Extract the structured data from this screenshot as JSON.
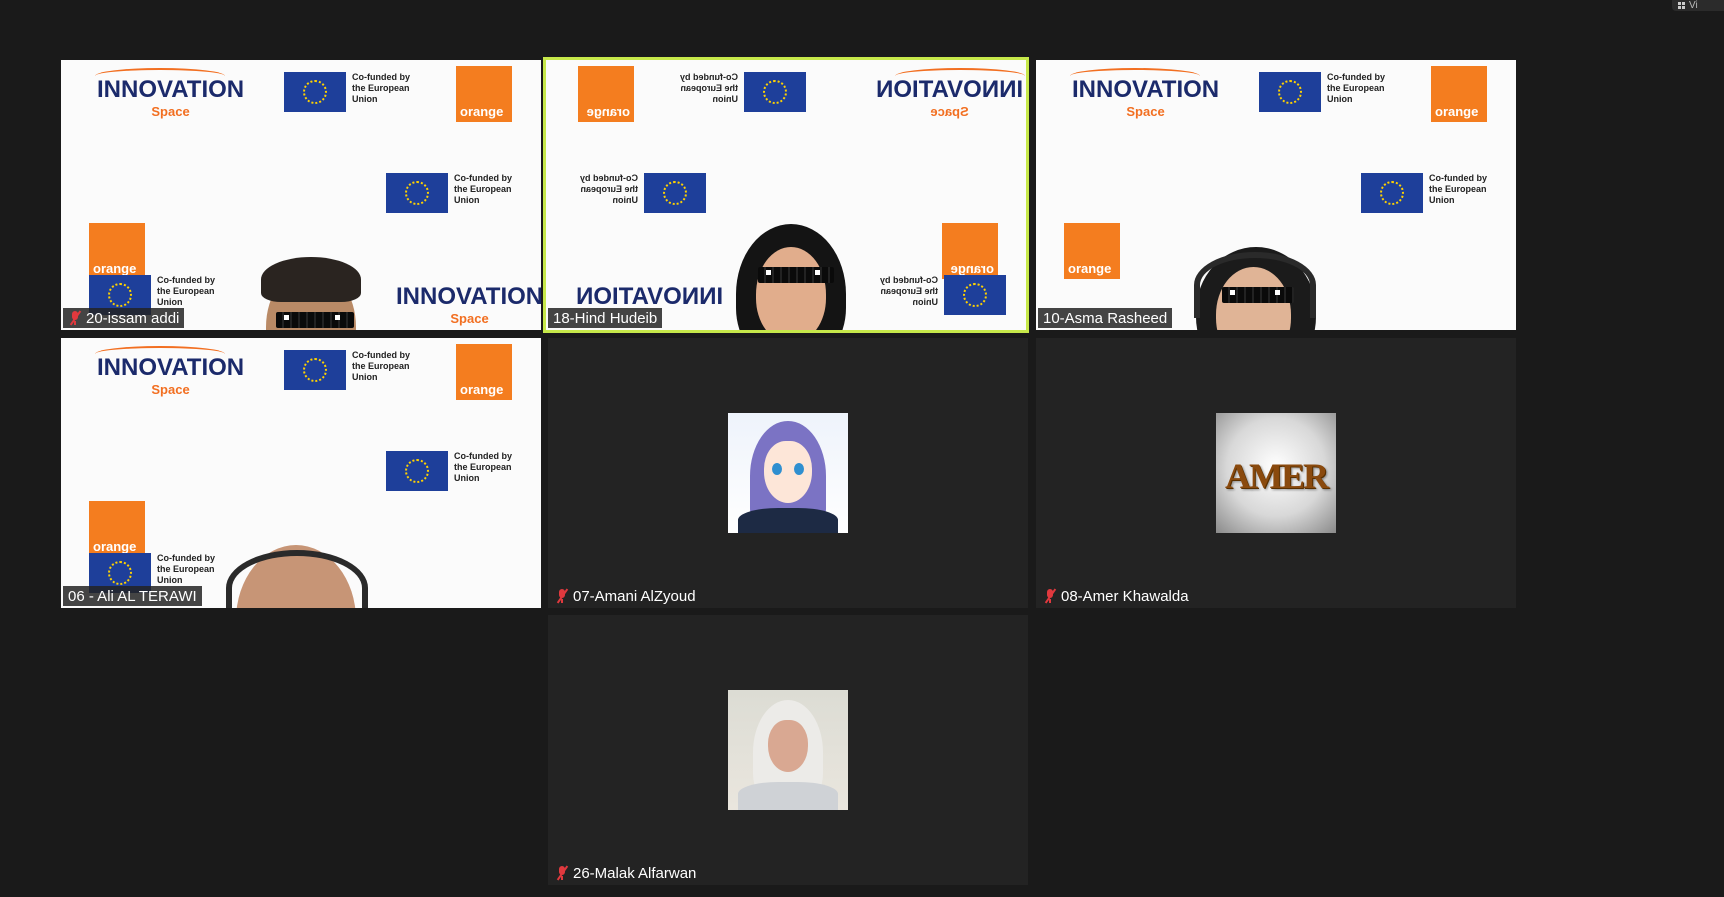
{
  "toolbar": {
    "view_label": "Vi"
  },
  "participants": [
    {
      "id": "p1",
      "name": "20-issam addi",
      "muted": true,
      "video": true,
      "active": false
    },
    {
      "id": "p2",
      "name": "18-Hind Hudeib",
      "muted": false,
      "video": true,
      "active": true
    },
    {
      "id": "p3",
      "name": "10-Asma Rasheed",
      "muted": false,
      "video": true,
      "active": false
    },
    {
      "id": "p4",
      "name": "06 - Ali AL TERAWI",
      "muted": false,
      "video": true,
      "active": false
    },
    {
      "id": "p5",
      "name": "07-Amani AlZyoud",
      "muted": true,
      "video": false,
      "avatar": "anime-hijab-avatar"
    },
    {
      "id": "p6",
      "name": "08-Amer Khawalda",
      "muted": true,
      "video": false,
      "avatar": "amer-text-avatar"
    },
    {
      "id": "p7",
      "name": "26-Malak Alfarwan",
      "muted": true,
      "video": false,
      "avatar": "photo-avatar"
    }
  ],
  "backdrop": {
    "innovation": "INNOVATION",
    "space": "Space",
    "eu_text": "Co-funded by the European Union",
    "orange": "orange"
  },
  "avatar_text": {
    "amer": "AMER"
  },
  "colors": {
    "background": "#1a1a1a",
    "tile": "#232323",
    "active_border": "#c6e84a",
    "muted_icon": "#e0393e",
    "brand_orange": "#f47d1f",
    "eu_blue": "#1e3f9a"
  }
}
